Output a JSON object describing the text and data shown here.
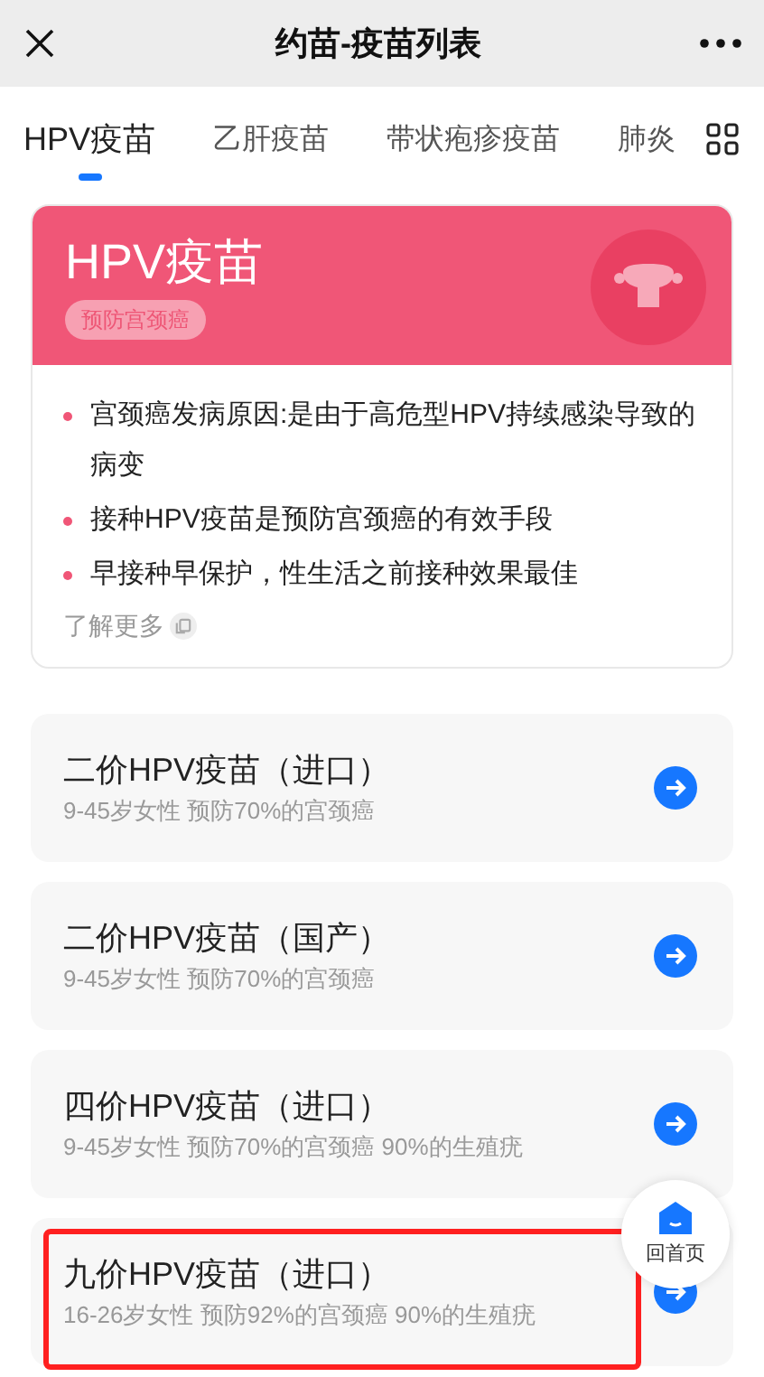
{
  "nav_bar": {
    "title": "约苗-疫苗列表"
  },
  "tabs": [
    {
      "label": "HPV疫苗",
      "selected": true
    },
    {
      "label": "乙肝疫苗",
      "selected": false
    },
    {
      "label": "带状疱疹疫苗",
      "selected": false
    },
    {
      "label": "肺炎",
      "selected": false
    }
  ],
  "intro_card": {
    "title": "HPV疫苗",
    "tag": "预防宫颈癌",
    "points": [
      "宫颈癌发病原因:是由于高危型HPV持续感染导致的病变",
      "接种HPV疫苗是预防宫颈癌的有效手段",
      "早接种早保护，性生活之前接种效果最佳"
    ],
    "more_link": "了解更多"
  },
  "vaccines": [
    {
      "name": "二价HPV疫苗（进口）",
      "detail": "9-45岁女性 预防70%的宫颈癌",
      "highlighted": false
    },
    {
      "name": "二价HPV疫苗（国产）",
      "detail": "9-45岁女性 预防70%的宫颈癌",
      "highlighted": false
    },
    {
      "name": "四价HPV疫苗（进口）",
      "detail": "9-45岁女性 预防70%的宫颈癌 90%的生殖疣",
      "highlighted": false
    },
    {
      "name": "九价HPV疫苗（进口）",
      "detail": "16-26岁女性 预防92%的宫颈癌 90%的生殖疣",
      "highlighted": true
    }
  ],
  "home_button": {
    "label": "回首页"
  }
}
